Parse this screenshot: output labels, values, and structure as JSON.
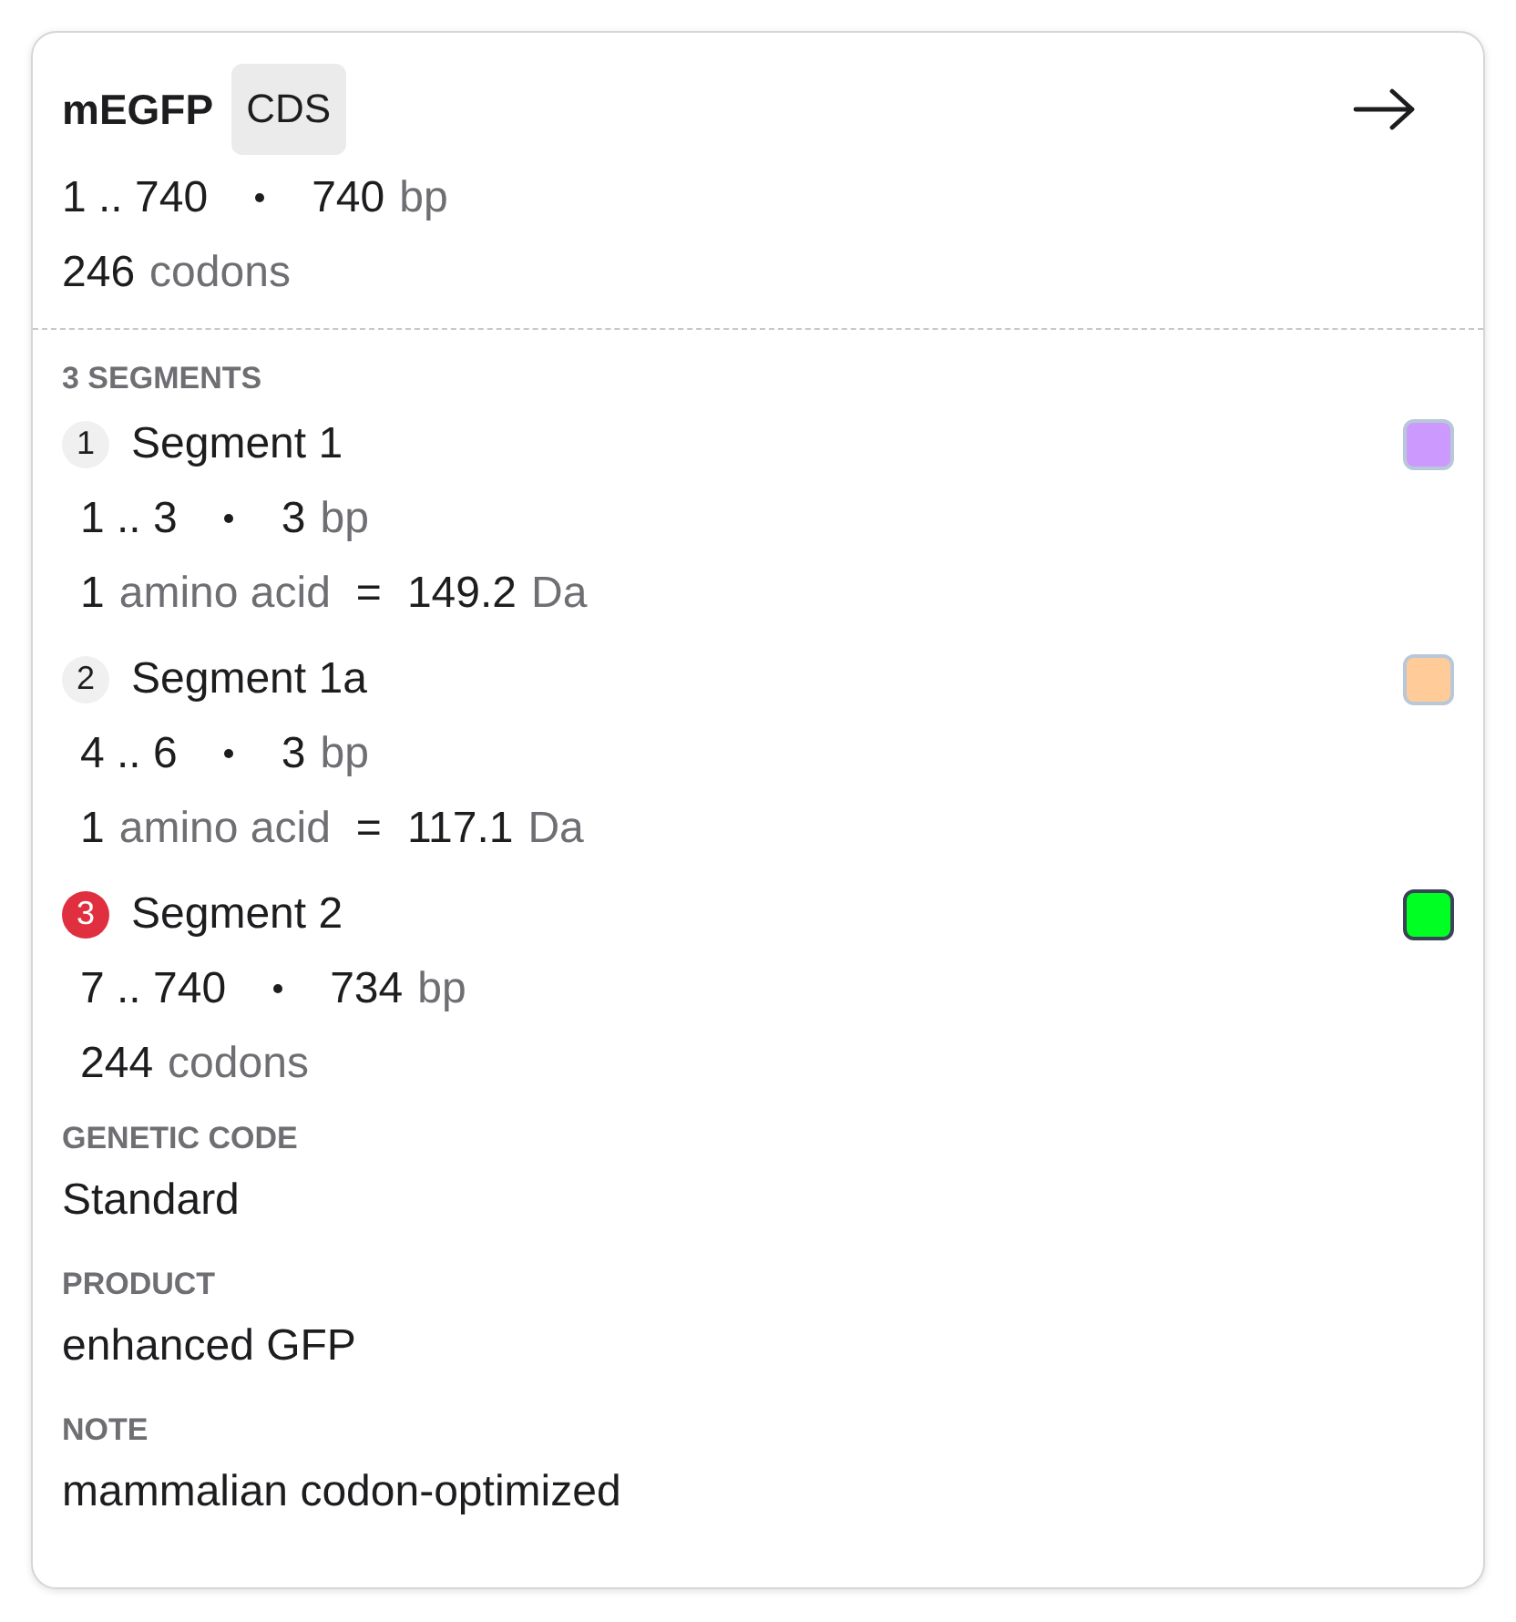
{
  "feature": {
    "name": "mEGFP",
    "type_tag": "CDS",
    "range": "1 .. 740",
    "length": "740",
    "length_unit": "bp",
    "codons": "246",
    "codons_unit": "codons"
  },
  "segments_heading": "3 SEGMENTS",
  "segments": [
    {
      "number": "1",
      "name": "Segment 1",
      "selected": false,
      "color": "#cc99ff",
      "range": "1 .. 3",
      "length": "3",
      "length_unit": "bp",
      "kind": "amino_acid",
      "count": "1",
      "count_unit": "amino acid",
      "equals": "=",
      "mass": "149.2",
      "mass_unit": "Da"
    },
    {
      "number": "2",
      "name": "Segment 1a",
      "selected": false,
      "color": "#ffcc99",
      "range": "4 .. 6",
      "length": "3",
      "length_unit": "bp",
      "kind": "amino_acid",
      "count": "1",
      "count_unit": "amino acid",
      "equals": "=",
      "mass": "117.1",
      "mass_unit": "Da"
    },
    {
      "number": "3",
      "name": "Segment 2",
      "selected": true,
      "color": "#00ff22",
      "range": "7 .. 740",
      "length": "734",
      "length_unit": "bp",
      "kind": "codons",
      "count": "244",
      "count_unit": "codons"
    }
  ],
  "fields": [
    {
      "label": "GENETIC CODE",
      "value": "Standard"
    },
    {
      "label": "PRODUCT",
      "value": "enhanced GFP"
    },
    {
      "label": "NOTE",
      "value": "mammalian codon-optimized"
    }
  ]
}
